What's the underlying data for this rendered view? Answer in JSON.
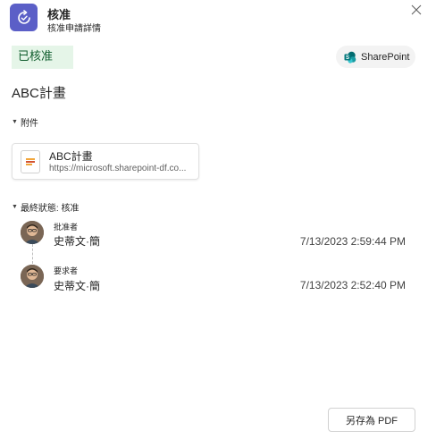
{
  "header": {
    "title": "核准",
    "subtitle": "核准申請詳情"
  },
  "status": {
    "label": "已核准",
    "color": "#e5f5e8"
  },
  "sharepoint_button": {
    "label": "SharePoint",
    "icon": "sharepoint-icon"
  },
  "request_title": "ABC計畫",
  "attachments": {
    "section_label": "附件",
    "items": [
      {
        "name": "ABC計畫",
        "url": "https://microsoft.sharepoint-df.co..."
      }
    ]
  },
  "final_status": {
    "section_label": "最終狀態: 核准",
    "entries": [
      {
        "role": "批准者",
        "name": "史蒂文·簡",
        "timestamp": "7/13/2023 2:59:44 PM"
      },
      {
        "role": "要求者",
        "name": "史蒂文·簡",
        "timestamp": "7/13/2023 2:52:40 PM"
      }
    ]
  },
  "footer": {
    "save_pdf_label": "另存為 PDF"
  },
  "colors": {
    "accent": "#5b5fc7",
    "sharepoint": "#038387"
  }
}
